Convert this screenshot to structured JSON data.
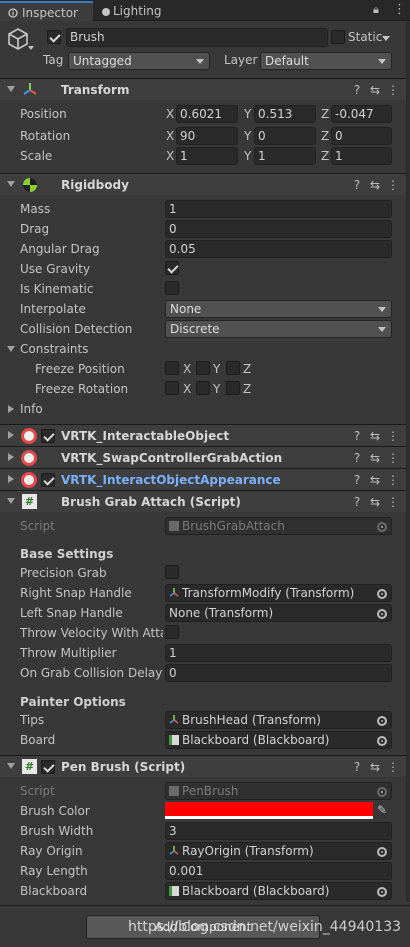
{
  "tabs": {
    "inspector": "Inspector",
    "lighting": "Lighting"
  },
  "header": {
    "name": "Brush",
    "static_label": "Static",
    "tag_label": "Tag",
    "tag_value": "Untagged",
    "layer_label": "Layer",
    "layer_value": "Default"
  },
  "transform": {
    "title": "Transform",
    "position_label": "Position",
    "rotation_label": "Rotation",
    "scale_label": "Scale",
    "position": {
      "x": "0.6021",
      "y": "0.513",
      "z": "-0.047"
    },
    "rotation": {
      "x": "90",
      "y": "0",
      "z": "0"
    },
    "scale": {
      "x": "1",
      "y": "1",
      "z": "1"
    },
    "axis_x": "X",
    "axis_y": "Y",
    "axis_z": "Z"
  },
  "rigidbody": {
    "title": "Rigidbody",
    "mass_label": "Mass",
    "mass": "1",
    "drag_label": "Drag",
    "drag": "0",
    "angular_drag_label": "Angular Drag",
    "angular_drag": "0.05",
    "use_gravity_label": "Use Gravity",
    "is_kinematic_label": "Is Kinematic",
    "interpolate_label": "Interpolate",
    "interpolate": "None",
    "collision_detection_label": "Collision Detection",
    "collision_detection": "Discrete",
    "constraints_label": "Constraints",
    "freeze_position_label": "Freeze Position",
    "freeze_rotation_label": "Freeze Rotation",
    "info_label": "Info"
  },
  "comp1": {
    "title": "VRTK_InteractableObject"
  },
  "comp2": {
    "title": "VRTK_SwapControllerGrabAction"
  },
  "comp3": {
    "title": "VRTK_InteractObjectAppearance"
  },
  "brush_grab": {
    "title": "Brush Grab Attach (Script)",
    "script_label": "Script",
    "script": "BrushGrabAttach",
    "base_settings": "Base Settings",
    "precision_grab_label": "Precision Grab",
    "right_snap_label": "Right Snap Handle",
    "right_snap": "TransformModify (Transform)",
    "left_snap_label": "Left Snap Handle",
    "left_snap": "None (Transform)",
    "throw_velocity_label": "Throw Velocity With Attac",
    "throw_multiplier_label": "Throw Multiplier",
    "throw_multiplier": "1",
    "collision_delay_label": "On Grab Collision Delay",
    "collision_delay": "0",
    "painter_options": "Painter Options",
    "tips_label": "Tips",
    "tips": "BrushHead (Transform)",
    "board_label": "Board",
    "board": "Blackboard (Blackboard)"
  },
  "pen_brush": {
    "title": "Pen Brush (Script)",
    "script_label": "Script",
    "script": "PenBrush",
    "brush_color_label": "Brush Color",
    "brush_color": "#ff0000",
    "brush_width_label": "Brush Width",
    "brush_width": "3",
    "ray_origin_label": "Ray Origin",
    "ray_origin": "RayOrigin (Transform)",
    "ray_length_label": "Ray Length",
    "ray_length": "0.001",
    "blackboard_label": "Blackboard",
    "blackboard": "Blackboard (Blackboard)"
  },
  "footer": {
    "add_component": "Add Component",
    "watermark": "https://blog.csdn.net/weixin_44940133"
  },
  "icons": {
    "help": "?",
    "settings": "⇆",
    "more": "⋮"
  }
}
